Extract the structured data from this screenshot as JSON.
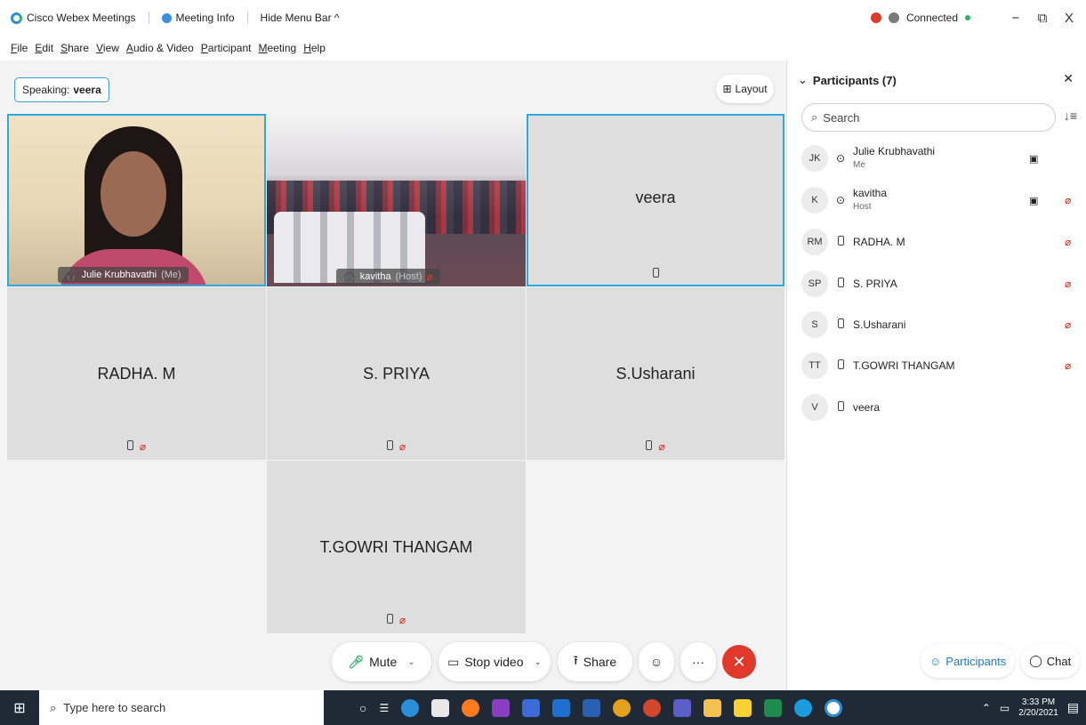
{
  "titlebar": {
    "app_name": "Cisco Webex Meetings",
    "meeting_info": "Meeting Info",
    "hide_menu": "Hide Menu Bar ^",
    "status": "Connected",
    "minimize": "−",
    "restore": "⧉",
    "close": "X"
  },
  "menu": [
    "File",
    "Edit",
    "Share",
    "View",
    "Audio & Video",
    "Participant",
    "Meeting",
    "Help"
  ],
  "stage": {
    "speaking_label": "Speaking:",
    "speaking_name": "veera",
    "layout_label": "Layout"
  },
  "tiles": {
    "julie": {
      "name": "Julie Krubhavathi",
      "tag": "(Me)"
    },
    "kavitha": {
      "name": "kavitha",
      "tag": "(Host)"
    },
    "veera": {
      "name": "veera"
    },
    "radha": {
      "name": "RADHA. M"
    },
    "priya": {
      "name": "S. PRIYA"
    },
    "usharani": {
      "name": "S.Usharani"
    },
    "gowri": {
      "name": "T.GOWRI THANGAM"
    }
  },
  "controls": {
    "mute": "Mute",
    "stop_video": "Stop video",
    "share": "Share",
    "more": "···",
    "end": "✕"
  },
  "panel": {
    "title": "Participants (7)",
    "search_placeholder": "Search",
    "participants": [
      {
        "initials": "JK",
        "name": "Julie Krubhavathi",
        "role": "Me"
      },
      {
        "initials": "K",
        "name": "kavitha",
        "role": "Host"
      },
      {
        "initials": "RM",
        "name": "RADHA. M",
        "role": ""
      },
      {
        "initials": "SP",
        "name": "S. PRIYA",
        "role": ""
      },
      {
        "initials": "S",
        "name": "S.Usharani",
        "role": ""
      },
      {
        "initials": "TT",
        "name": "T.GOWRI THANGAM",
        "role": ""
      },
      {
        "initials": "V",
        "name": "veera",
        "role": ""
      }
    ],
    "tab_participants": "Participants",
    "tab_chat": "Chat"
  },
  "taskbar": {
    "search_placeholder": "Type here to search",
    "time": "3:33 PM",
    "date": "2/20/2021"
  },
  "colors": {
    "accent": "#2fa8e0",
    "end_call": "#e0392b",
    "connected": "#2fb36f"
  }
}
